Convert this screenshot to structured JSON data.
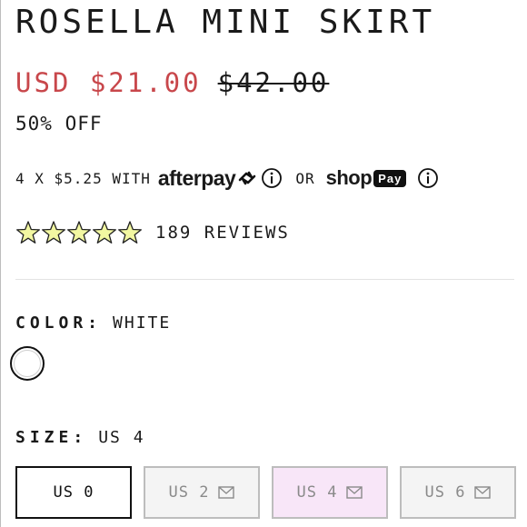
{
  "product": {
    "title": "ROSELLA MINI SKIRT",
    "sale_price": "USD $21.00",
    "original_price": "$42.00",
    "discount": "50% OFF"
  },
  "payments": {
    "installment_text": "4 X $5.25 WITH",
    "afterpay_logo": "afterpay",
    "or_text": "OR",
    "shop_word": "shop",
    "pay_badge": "Pay"
  },
  "reviews": {
    "rating": 5,
    "count_text": "189 REVIEWS",
    "star_color": "#f2f7a1"
  },
  "color": {
    "label": "COLOR:",
    "value": "WHITE",
    "swatch_color": "#ffffff"
  },
  "size": {
    "label": "SIZE:",
    "value": "US 4",
    "options": [
      {
        "label": "US 0",
        "state": "available"
      },
      {
        "label": "US 2",
        "state": "soldout",
        "icon": "mail-icon"
      },
      {
        "label": "US 4",
        "state": "selected",
        "icon": "mail-icon"
      },
      {
        "label": "US 6",
        "state": "soldout",
        "icon": "mail-icon"
      }
    ]
  },
  "colors": {
    "sale_red": "#c8474b",
    "selected_pink": "#f8e6f8"
  }
}
